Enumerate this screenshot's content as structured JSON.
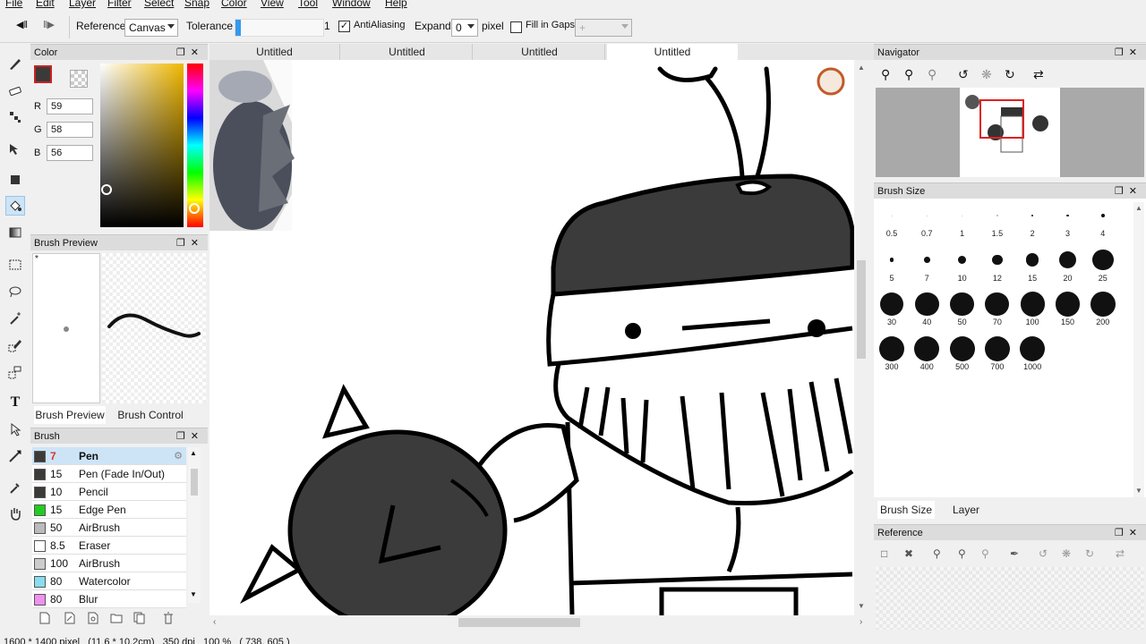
{
  "menu": [
    "File",
    "Edit",
    "Layer",
    "Filter",
    "Select",
    "Snap",
    "Color",
    "View",
    "Tool",
    "Window",
    "Help"
  ],
  "toolbar": {
    "reference_label": "Reference",
    "reference_value": "Canvas",
    "tolerance_label": "Tolerance",
    "tolerance_value": "1",
    "tolerance_fraction": 0.02,
    "antialiasing_label": "AntiAliasing",
    "antialiasing_checked": true,
    "expand_label": "Expand",
    "expand_value": "0",
    "expand_unit": "pixel",
    "fill_gaps_label": "Fill in Gaps",
    "fill_gaps_checked": false,
    "fill_gaps_value": "+"
  },
  "tools": [
    "pen-icon",
    "eraser-icon",
    "dot-pen-icon",
    "move-icon",
    "fill-rect-icon",
    "bucket-icon",
    "gradient-icon",
    "select-rect-icon",
    "lasso-icon",
    "magic-wand-icon",
    "select-pen-icon",
    "select-eraser-icon",
    "text-icon",
    "operation-icon",
    "divide-icon",
    "eyedropper-icon",
    "hand-icon"
  ],
  "color_panel": {
    "title": "Color",
    "r_label": "R",
    "r_value": "59",
    "g_label": "G",
    "g_value": "58",
    "b_label": "B",
    "b_value": "56",
    "current_color": "#3b3a38"
  },
  "brush_preview": {
    "title": "Brush Preview",
    "size_mark": "*",
    "tabs": [
      "Brush Preview",
      "Brush Control"
    ]
  },
  "brush_panel": {
    "title": "Brush",
    "items": [
      {
        "color": "#3b3a38",
        "size": "7",
        "name": "Pen",
        "selected": true
      },
      {
        "color": "#3b3a38",
        "size": "15",
        "name": "Pen (Fade In/Out)",
        "selected": false
      },
      {
        "color": "#3b3a38",
        "size": "10",
        "name": "Pencil",
        "selected": false
      },
      {
        "color": "#22cc22",
        "size": "15",
        "name": "Edge Pen",
        "selected": false
      },
      {
        "color": "#bbbbbb",
        "size": "50",
        "name": "AirBrush",
        "selected": false
      },
      {
        "color": "#ffffff",
        "size": "8.5",
        "name": "Eraser",
        "selected": false
      },
      {
        "color": "#cccccc",
        "size": "100",
        "name": "AirBrush",
        "selected": false
      },
      {
        "color": "#88ddee",
        "size": "80",
        "name": "Watercolor",
        "selected": false
      },
      {
        "color": "#f090f0",
        "size": "80",
        "name": "Blur",
        "selected": false
      }
    ]
  },
  "doc_tabs": [
    "Untitled",
    "Untitled",
    "Untitled",
    "Untitled"
  ],
  "navigator": {
    "title": "Navigator"
  },
  "brush_size": {
    "title": "Brush Size",
    "sizes": [
      "0.5",
      "0.7",
      "1",
      "1.5",
      "2",
      "3",
      "4",
      "5",
      "7",
      "10",
      "12",
      "15",
      "20",
      "25",
      "30",
      "40",
      "50",
      "70",
      "100",
      "150",
      "200",
      "300",
      "400",
      "500",
      "700",
      "1000"
    ],
    "tabs": [
      "Brush Size",
      "Layer"
    ]
  },
  "reference": {
    "title": "Reference"
  },
  "status": "1600 * 1400 pixel   (11.6 * 10.2cm)   350 dpi   100 %   ( 738, 605 )"
}
